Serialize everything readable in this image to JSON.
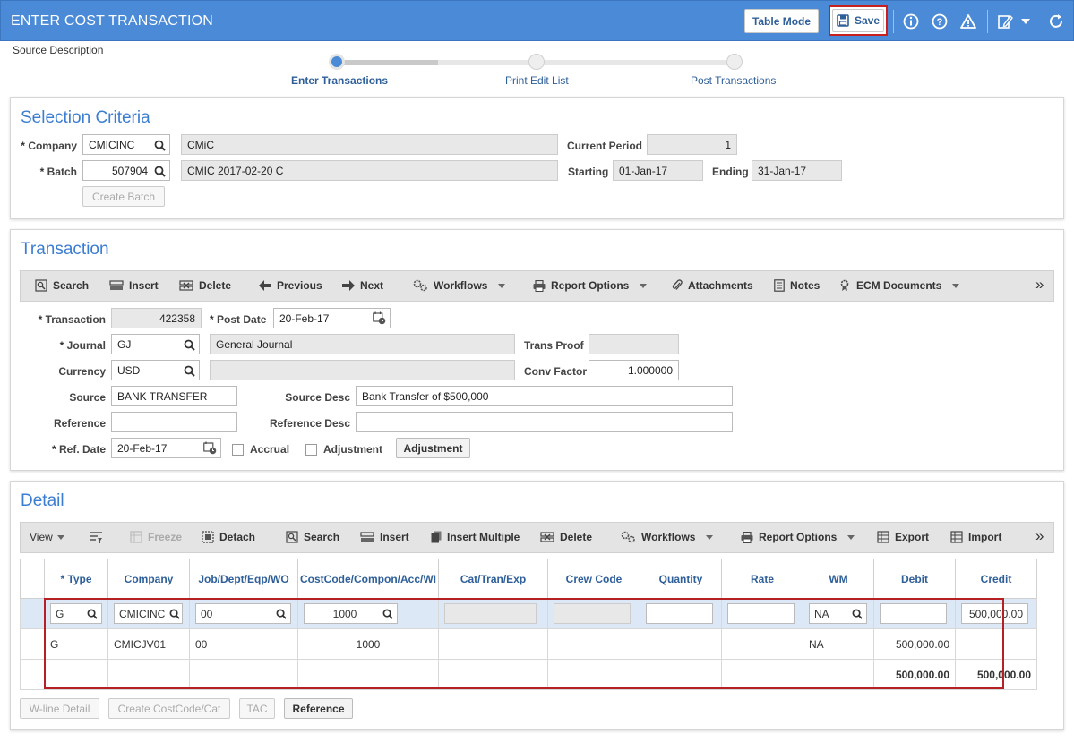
{
  "header": {
    "title": "ENTER COST TRANSACTION",
    "table_mode_label": "Table Mode",
    "save_label": "Save",
    "accent_color": "#4a8ad6"
  },
  "source_description_label": "Source Description",
  "train": {
    "steps": [
      "Enter Transactions",
      "Print Edit List",
      "Post Transactions"
    ],
    "active_index": 0
  },
  "selection": {
    "title": "Selection Criteria",
    "company_label": "Company",
    "company_value": "CMICINC",
    "company_name": "CMiC",
    "current_period_label": "Current Period",
    "current_period_value": "1",
    "batch_label": "Batch",
    "batch_value": "507904",
    "batch_name": "CMIC 2017-02-20 C",
    "starting_label": "Starting",
    "starting_value": "01-Jan-17",
    "ending_label": "Ending",
    "ending_value": "31-Jan-17",
    "create_batch_label": "Create Batch"
  },
  "transaction": {
    "title": "Transaction",
    "toolbar": {
      "search": "Search",
      "insert": "Insert",
      "delete": "Delete",
      "previous": "Previous",
      "next": "Next",
      "workflows": "Workflows",
      "report_options": "Report Options",
      "attachments": "Attachments",
      "notes": "Notes",
      "ecm_documents": "ECM Documents",
      "more": "»"
    },
    "transaction_label": "Transaction",
    "transaction_value": "422358",
    "post_date_label": "Post Date",
    "post_date_value": "20-Feb-17",
    "journal_label": "Journal",
    "journal_value": "GJ",
    "journal_name": "General Journal",
    "trans_proof_label": "Trans Proof",
    "trans_proof_value": "",
    "currency_label": "Currency",
    "currency_value": "USD",
    "currency_name": "",
    "conv_factor_label": "Conv Factor",
    "conv_factor_value": "1.000000",
    "source_label": "Source",
    "source_value": "BANK TRANSFER",
    "source_desc_label": "Source Desc",
    "source_desc_value": "Bank Transfer of $500,000",
    "reference_label": "Reference",
    "reference_value": "",
    "reference_desc_label": "Reference Desc",
    "reference_desc_value": "",
    "ref_date_label": "Ref. Date",
    "ref_date_value": "20-Feb-17",
    "accrual_label": "Accrual",
    "adjustment_label": "Adjustment",
    "adjustment_button": "Adjustment"
  },
  "detail": {
    "title": "Detail",
    "toolbar": {
      "view": "View",
      "freeze": "Freeze",
      "detach": "Detach",
      "search": "Search",
      "insert": "Insert",
      "insert_multiple": "Insert Multiple",
      "delete": "Delete",
      "workflows": "Workflows",
      "report_options": "Report Options",
      "export": "Export",
      "import": "Import",
      "more": "»"
    },
    "columns": [
      "* Type",
      "Company",
      "Job/Dept/Eqp/WO",
      "CostCode/Compon/Acc/WI",
      "Cat/Tran/Exp",
      "Crew Code",
      "Quantity",
      "Rate",
      "WM",
      "Debit",
      "Credit"
    ],
    "edit_row": {
      "type": "G",
      "company": "CMICINC",
      "job": "00",
      "costcode": "1000",
      "cat": "",
      "crew": "",
      "quantity": "",
      "rate": "",
      "wm": "NA",
      "debit": "",
      "credit": "500,000.00"
    },
    "rows": [
      {
        "type": "G",
        "company": "CMICJV01",
        "job": "00",
        "costcode": "1000",
        "cat": "",
        "crew": "",
        "quantity": "",
        "rate": "",
        "wm": "NA",
        "debit": "500,000.00",
        "credit": ""
      }
    ],
    "totals": {
      "debit": "500,000.00",
      "credit": "500,000.00"
    },
    "buttons": {
      "wline": "W-line Detail",
      "create_costcode": "Create CostCode/Cat",
      "tac": "TAC",
      "reference": "Reference"
    }
  }
}
